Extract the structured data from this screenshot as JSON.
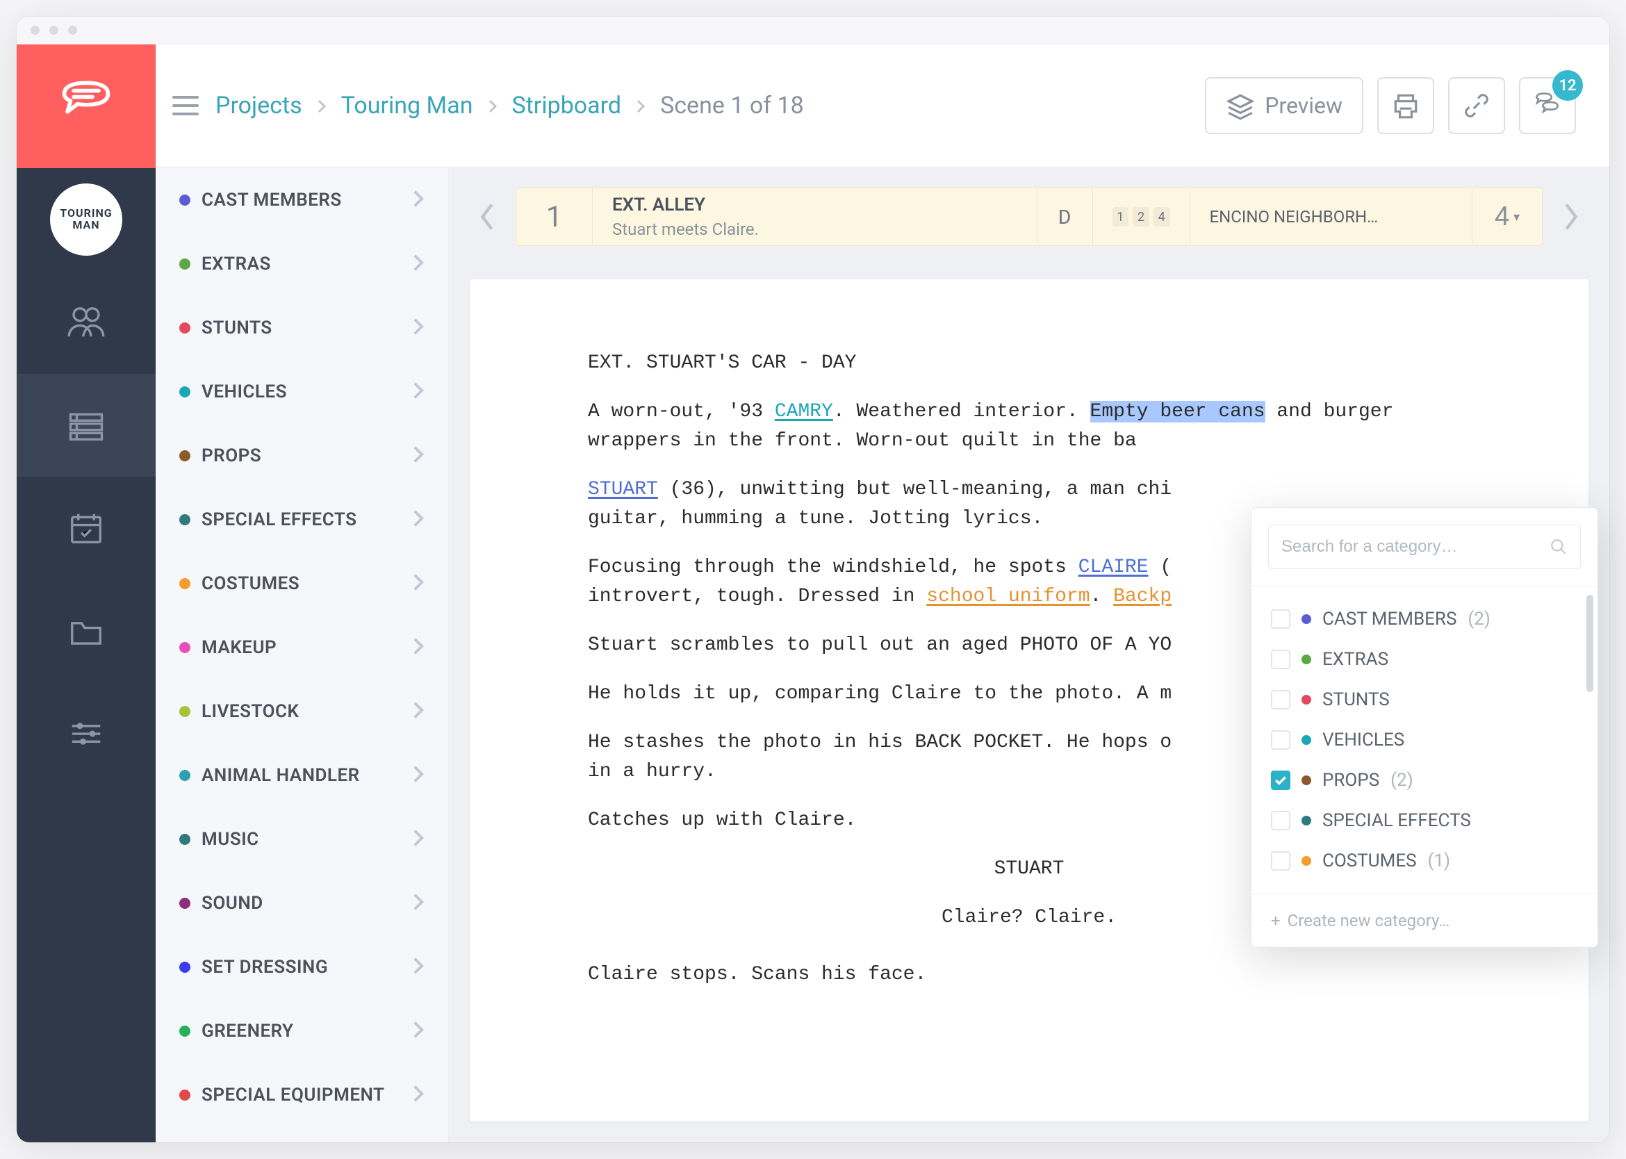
{
  "nav": {
    "project_label_top": "TOURING",
    "project_label_bottom": "MAN"
  },
  "breadcrumbs": {
    "root": "Projects",
    "project": "Touring Man",
    "section": "Stripboard",
    "current": "Scene 1 of 18"
  },
  "header": {
    "preview_label": "Preview",
    "comments_badge": "12"
  },
  "categories": [
    {
      "label": "CAST MEMBERS",
      "color": "#5b5bd6"
    },
    {
      "label": "EXTRAS",
      "color": "#5aa848"
    },
    {
      "label": "STUNTS",
      "color": "#e24b5b"
    },
    {
      "label": "VEHICLES",
      "color": "#1aa7b8"
    },
    {
      "label": "PROPS",
      "color": "#8b5a2b"
    },
    {
      "label": "SPECIAL EFFECTS",
      "color": "#2f7a7f"
    },
    {
      "label": "COSTUMES",
      "color": "#f59c2f"
    },
    {
      "label": "MAKEUP",
      "color": "#e94fb8"
    },
    {
      "label": "LIVESTOCK",
      "color": "#a9c23a"
    },
    {
      "label": "ANIMAL HANDLER",
      "color": "#2f9fb3"
    },
    {
      "label": "MUSIC",
      "color": "#2f7a7f"
    },
    {
      "label": "SOUND",
      "color": "#8b2f7a"
    },
    {
      "label": "SET DRESSING",
      "color": "#3a3af0"
    },
    {
      "label": "GREENERY",
      "color": "#26b05a"
    },
    {
      "label": "SPECIAL EQUIPMENT",
      "color": "#e2494c"
    }
  ],
  "strip": {
    "number": "1",
    "slug": "EXT. ALLEY",
    "description": "Stuart meets Claire.",
    "day_night": "D",
    "characters": [
      "1",
      "2",
      "4"
    ],
    "location": "ENCINO NEIGHBORH…",
    "eighths": "4"
  },
  "script": {
    "slugline": "EXT. STUART'S CAR - DAY",
    "p1a": "A worn-out, '93 ",
    "p1_camry": "CAMRY",
    "p1b": ". Weathered interior. ",
    "p1_cans": "Empty beer cans",
    "p1c": " and burger wrappers in the front. Worn-out quilt in the ba",
    "p2a_stuart": "STUART",
    "p2b": " (36), unwitting but well-meaning, a man chi",
    "p2c": "guitar, humming a tune. Jotting lyrics.",
    "p3a": "Focusing through the windshield, he spots ",
    "p3_claire": "CLAIRE",
    "p3b": " (",
    "p3c": "introvert, tough. Dressed in ",
    "p3_uniform": "school uniform",
    "p3d": ". ",
    "p3_backpack": "Backp",
    "p4": "Stuart scrambles to pull out an aged PHOTO OF A YO",
    "p5": "He holds it up, comparing Claire to the photo. A m",
    "p6": "He stashes the photo in his BACK POCKET. He hops o",
    "p6b": "in a hurry.",
    "p7": "Catches up with Claire.",
    "char1": "STUART",
    "dialogue1": "Claire? Claire.",
    "p8": "Claire stops. Scans his face."
  },
  "popover": {
    "search_placeholder": "Search for a category…",
    "items": [
      {
        "label": "CAST MEMBERS",
        "count": "(2)",
        "color": "#5b5bd6",
        "checked": false
      },
      {
        "label": "EXTRAS",
        "count": "",
        "color": "#5aa848",
        "checked": false
      },
      {
        "label": "STUNTS",
        "count": "",
        "color": "#e24b5b",
        "checked": false
      },
      {
        "label": "VEHICLES",
        "count": "",
        "color": "#1aa7b8",
        "checked": false
      },
      {
        "label": "PROPS",
        "count": "(2)",
        "color": "#8b5a2b",
        "checked": true
      },
      {
        "label": "SPECIAL EFFECTS",
        "count": "",
        "color": "#2f7a7f",
        "checked": false
      },
      {
        "label": "COSTUMES",
        "count": "(1)",
        "color": "#f59c2f",
        "checked": false
      }
    ],
    "create_label": "Create new category…"
  }
}
